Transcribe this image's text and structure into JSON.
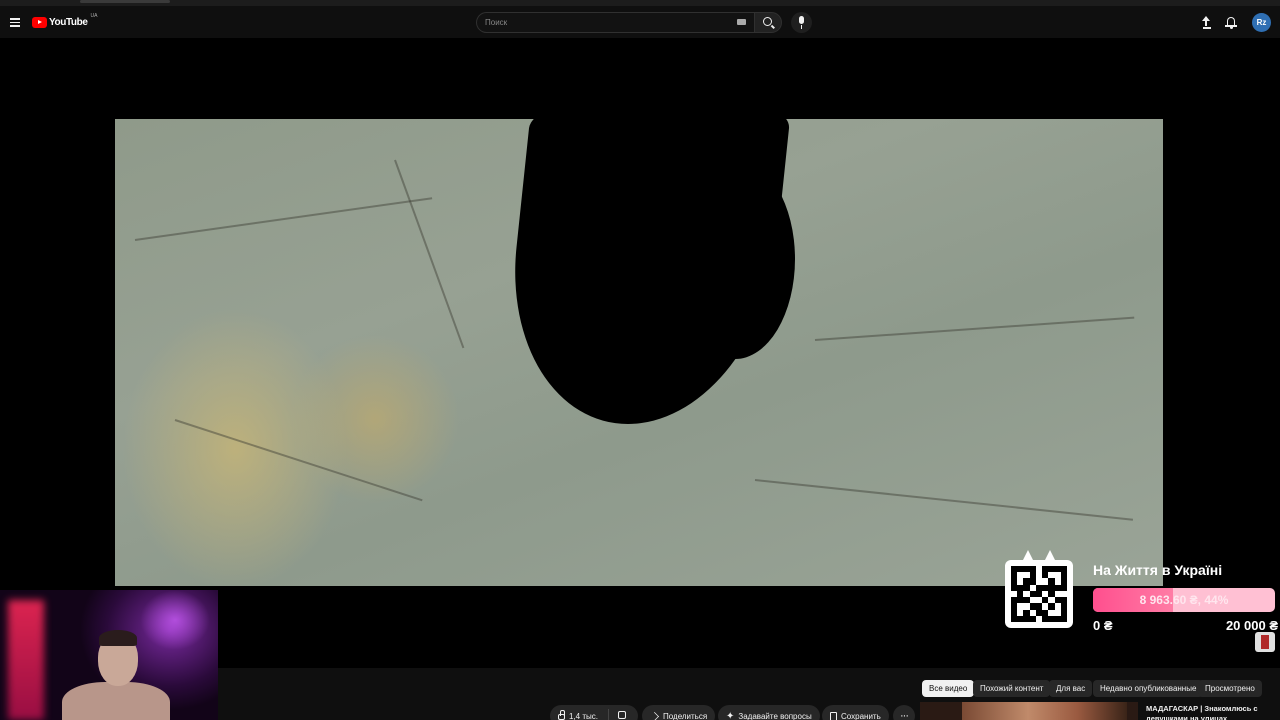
{
  "header": {
    "logo_text": "YouTube",
    "country_code": "UA",
    "search_placeholder": "Поиск",
    "avatar_initials": "Rz",
    "icons": [
      "menu-icon",
      "search-icon",
      "keyboard-icon",
      "mic-icon",
      "upload-icon",
      "bell-icon"
    ]
  },
  "donation": {
    "title": "На Життя в Україні",
    "progress_label": "8 963.60 ₴, 44%",
    "progress_percent": 44,
    "min_label": "0 ₴",
    "max_label": "20 000 ₴",
    "colors": {
      "fill": "#ff4f8e",
      "track": "#ffc0d3"
    }
  },
  "actions": {
    "likes": "1,4 тыс.",
    "share": "Поделиться",
    "ask": "Задавайте вопросы",
    "save": "Сохранить",
    "more": "···"
  },
  "filter_chips": [
    {
      "label": "Все видео",
      "active": true
    },
    {
      "label": "Похожий контент",
      "active": false
    },
    {
      "label": "Для вас",
      "active": false
    },
    {
      "label": "Недавно опубликованные",
      "active": false
    },
    {
      "label": "Просмотрено",
      "active": false
    }
  ],
  "recommendation": {
    "title": "МАДАГАСКАР | Знакомлюсь с девушками на улицах Антананариву"
  },
  "colors": {
    "background": "#0f0f0f",
    "chip_bg": "#272727",
    "chip_active_bg": "#f1f1f1",
    "brand_red": "#ff0000"
  }
}
